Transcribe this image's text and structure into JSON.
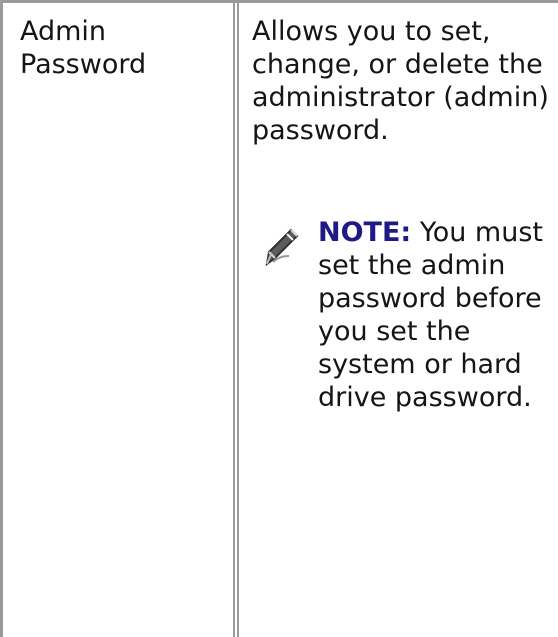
{
  "table": {
    "row": {
      "label": "Admin Password",
      "description": "Allows you to set, change, or delete the administrator (admin) password.",
      "note": {
        "label": "NOTE:",
        "text": "You must set the admin password before you set the system or hard drive password.",
        "icon": "note-pencil-icon"
      }
    }
  },
  "colors": {
    "border": "#9a9a9a",
    "note_label": "#1f1a86",
    "text": "#151515"
  }
}
